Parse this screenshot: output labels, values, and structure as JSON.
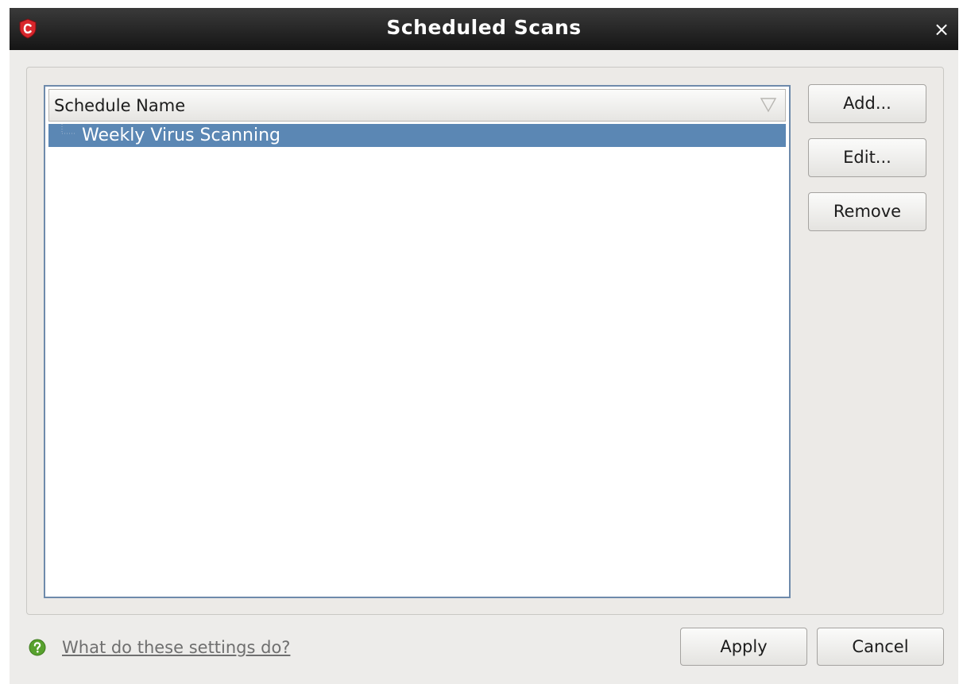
{
  "window": {
    "title": "Scheduled Scans",
    "close_symbol": "×",
    "app_icon": "comodo-shield-icon"
  },
  "list": {
    "column_header": "Schedule Name",
    "sort_icon": "sort-triangle-icon",
    "rows": [
      {
        "label": "Weekly Virus Scanning",
        "selected": true
      }
    ]
  },
  "side_buttons": {
    "add_label": "Add...",
    "edit_label": "Edit...",
    "remove_label": "Remove"
  },
  "footer": {
    "help_icon": "question-mark-icon",
    "help_text": "What do these settings do?",
    "apply_label": "Apply",
    "cancel_label": "Cancel"
  },
  "colors": {
    "titlebar": "#1f1f1f",
    "selection": "#5b87b4",
    "list_border": "#6e8aab",
    "help_icon": "#58a12e"
  }
}
